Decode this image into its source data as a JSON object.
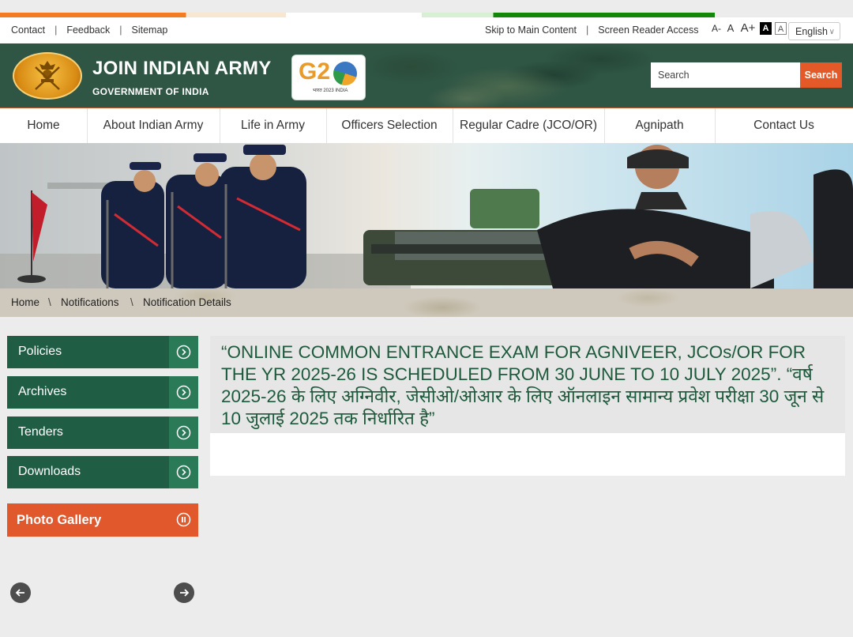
{
  "top_links": {
    "contact": "Contact",
    "feedback": "Feedback",
    "sitemap": "Sitemap"
  },
  "accessibility": {
    "skip": "Skip to Main Content",
    "screen_reader": "Screen Reader Access",
    "font_decrease": "A-",
    "font_normal": "A",
    "font_increase": "A+",
    "contrast_dark": "A",
    "contrast_light": "A"
  },
  "language": {
    "selected": "English"
  },
  "brand": {
    "title": "JOIN INDIAN ARMY",
    "subtitle": "GOVERNMENT OF INDIA"
  },
  "g20": {
    "logo_text": "G2",
    "tagline": "भारत 2023 INDIA"
  },
  "search": {
    "placeholder": "Search",
    "button": "Search"
  },
  "nav": [
    {
      "label": "Home"
    },
    {
      "label": "About Indian Army"
    },
    {
      "label": "Life in Army"
    },
    {
      "label": "Officers Selection"
    },
    {
      "label": "Regular Cadre (JCO/OR)"
    },
    {
      "label": "Agnipath"
    },
    {
      "label": "Contact Us"
    }
  ],
  "breadcrumb": {
    "items": [
      "Home",
      "Notifications",
      "Notification Details"
    ],
    "separator": "\\"
  },
  "sidebar": {
    "items": [
      {
        "label": "Policies"
      },
      {
        "label": "Archives"
      },
      {
        "label": "Tenders"
      },
      {
        "label": "Downloads"
      }
    ],
    "photo_gallery": "Photo Gallery"
  },
  "notification": {
    "title": "“ONLINE COMMON ENTRANCE EXAM FOR AGNIVEER, JCOs/OR FOR THE YR 2025-26 IS SCHEDULED FROM 30 JUNE TO 10 JULY 2025”. “वर्ष 2025-26 के लिए अग्निवीर, जेसीओ/ओआर के लिए ऑनलाइन सामान्य प्रवेश परीक्षा 30 जून से 10 जुलाई 2025 तक निर्धारित है”"
  },
  "colors": {
    "header_green": "#2f5544",
    "accent_orange": "#e35a28",
    "sidebar_green": "#1f5e45",
    "title_green": "#1d5a3c"
  }
}
